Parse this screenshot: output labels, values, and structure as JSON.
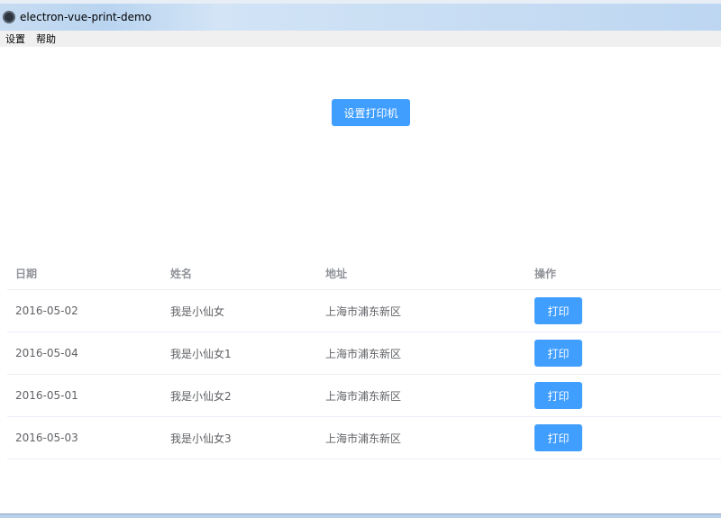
{
  "window": {
    "title": "electron-vue-print-demo"
  },
  "menu": [
    "设置",
    "帮助"
  ],
  "setup_button": "设置打印机",
  "table": {
    "headers": [
      "日期",
      "姓名",
      "地址",
      "操作"
    ],
    "rows": [
      {
        "date": "2016-05-02",
        "name": "我是小仙女",
        "address": "上海市浦东新区",
        "action": "打印"
      },
      {
        "date": "2016-05-04",
        "name": "我是小仙女1",
        "address": "上海市浦东新区",
        "action": "打印"
      },
      {
        "date": "2016-05-01",
        "name": "我是小仙女2",
        "address": "上海市浦东新区",
        "action": "打印"
      },
      {
        "date": "2016-05-03",
        "name": "我是小仙女3",
        "address": "上海市浦东新区",
        "action": "打印"
      }
    ]
  },
  "colors": {
    "primary": "#409eff"
  }
}
